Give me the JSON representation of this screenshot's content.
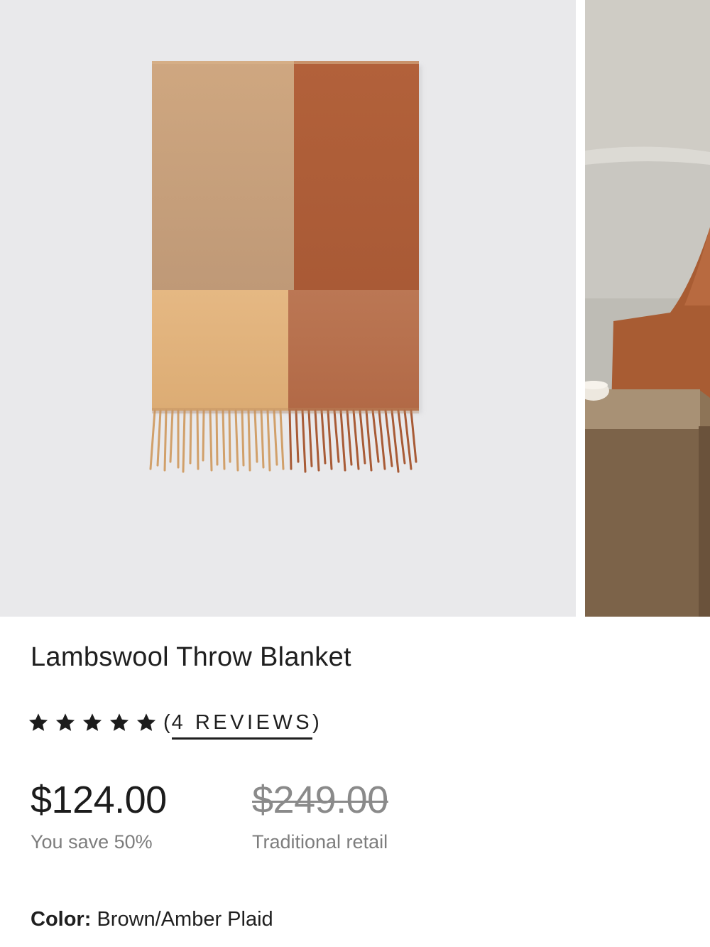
{
  "product": {
    "title": "Lambswool Throw Blanket",
    "rating": {
      "stars": 5,
      "reviews_open": "(",
      "reviews_text": "4 REVIEWS",
      "reviews_close": ")"
    },
    "pricing": {
      "sale_price": "$124.00",
      "savings_text": "You save 50%",
      "retail_price": "$249.00",
      "retail_note": "Traditional retail"
    },
    "color": {
      "label": "Color:",
      "value": "Brown/Amber Plaid"
    }
  },
  "carousel": {
    "slides": [
      {
        "name": "product-photo-folded-blanket"
      },
      {
        "name": "lifestyle-photo-sofa"
      }
    ]
  },
  "colors": {
    "blanket_light": "#c9a37c",
    "blanket_dark": "#b0643c",
    "blanket_tan": "#e3b57c",
    "blanket_rust": "#b8714a",
    "photo_background": "#e9e9eb",
    "star": "#1c1c1c",
    "muted_text": "#7d7d7d"
  }
}
